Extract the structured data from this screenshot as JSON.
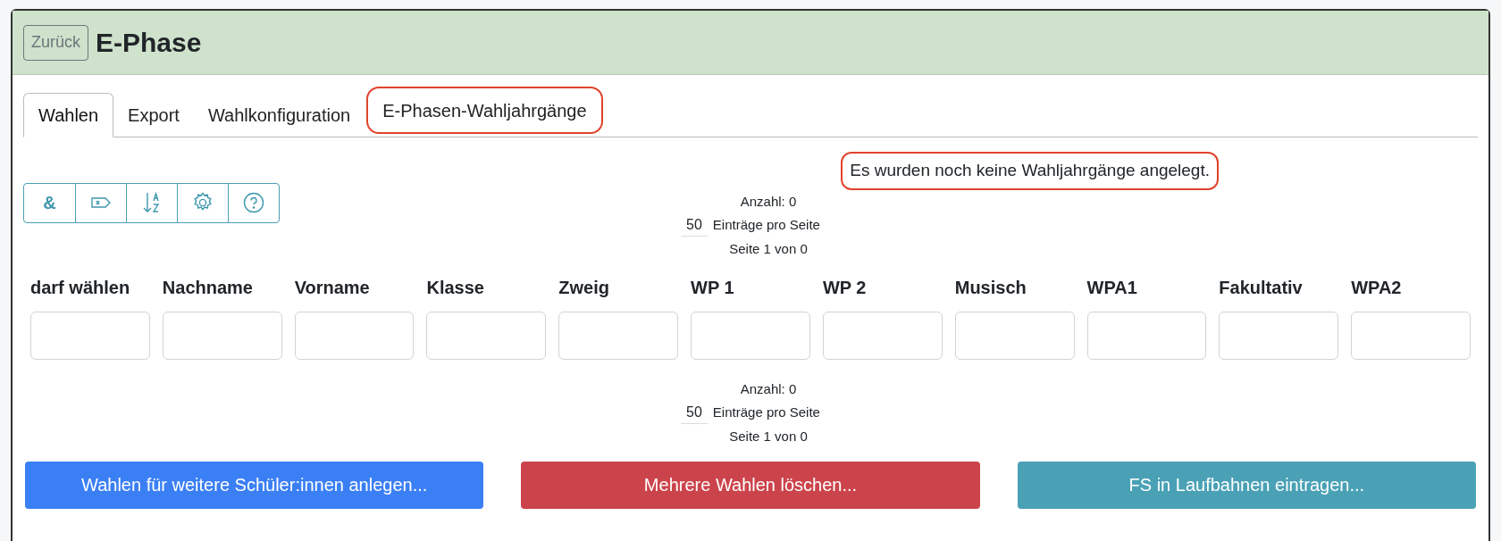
{
  "header": {
    "back_button": "Zurück",
    "title": "E-Phase"
  },
  "tabs": [
    {
      "label": "Wahlen",
      "selected": true,
      "highlighted": false
    },
    {
      "label": "Export",
      "selected": false,
      "highlighted": false
    },
    {
      "label": "Wahlkonfiguration",
      "selected": false,
      "highlighted": false
    },
    {
      "label": "E-Phasen-Wahljahrgänge",
      "selected": false,
      "highlighted": true
    }
  ],
  "message": {
    "text": "Es wurden noch keine Wahljahrgänge angelegt.",
    "highlighted": true
  },
  "toolbar": [
    {
      "kind": "ampersand",
      "label": "&"
    },
    {
      "kind": "tag"
    },
    {
      "kind": "sort"
    },
    {
      "kind": "settings"
    },
    {
      "kind": "help"
    }
  ],
  "pagination_top": {
    "count": "Anzahl: 0",
    "per_page": "50",
    "per_page_label": "Einträge pro Seite",
    "page": "Seite 1 von 0"
  },
  "columns": [
    {
      "label": "darf wählen"
    },
    {
      "label": "Nachname"
    },
    {
      "label": "Vorname"
    },
    {
      "label": "Klasse"
    },
    {
      "label": "Zweig"
    },
    {
      "label": "WP 1"
    },
    {
      "label": "WP 2"
    },
    {
      "label": "Musisch"
    },
    {
      "label": "WPA1"
    },
    {
      "label": "Fakultativ"
    },
    {
      "label": "WPA2"
    }
  ],
  "pagination_bottom": {
    "count": "Anzahl: 0",
    "per_page": "50",
    "per_page_label": "Einträge pro Seite",
    "page": "Seite 1 von 0"
  },
  "actions": [
    {
      "label": "Wahlen für weitere Schüler:innen anlegen...",
      "kind": "primary"
    },
    {
      "label": "Mehrere Wahlen löschen...",
      "kind": "danger"
    },
    {
      "label": "FS in Laufbahnen eintragen...",
      "kind": "info"
    }
  ]
}
